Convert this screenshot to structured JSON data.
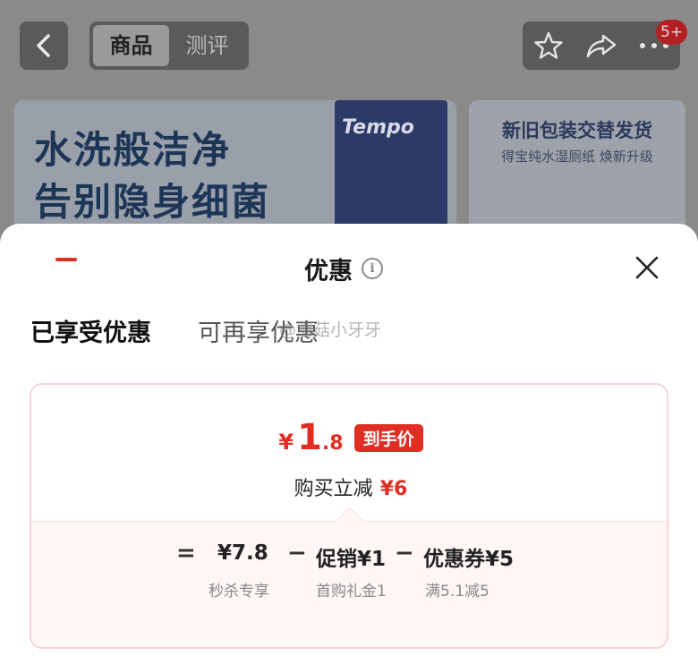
{
  "header": {
    "back_icon": "chevron-left-icon",
    "tabs": [
      "商品",
      "测评"
    ],
    "actions": [
      "star-icon",
      "share-icon",
      "more-icon"
    ],
    "badge": "5+"
  },
  "banner_left": {
    "line1": "水洗般洁净",
    "line2": "告别隐身细菌",
    "brand": "Tempo"
  },
  "banner_right": {
    "title": "新旧包装交替发货",
    "subtitle": "得宝纯水湿厕纸 焕新升级"
  },
  "sheet": {
    "title": "优惠",
    "tabs": [
      "已享受优惠",
      "可再享优惠"
    ],
    "active_tab": 0,
    "watermark": "@蘑菇小牙牙",
    "final_price": {
      "symbol": "¥",
      "integer": "1",
      "decimal": ".8",
      "tag": "到手价"
    },
    "instant_discount": {
      "label": "购买立减",
      "amount": "¥6"
    },
    "breakdown": {
      "equals": "=",
      "minus": "−",
      "original": {
        "value": "¥7.8",
        "label": "秒杀专享"
      },
      "promo": {
        "value": "促销¥1",
        "label": "首购礼金1"
      },
      "coupon": {
        "value": "优惠券¥5",
        "label": "满5.1减5"
      }
    }
  },
  "colors": {
    "accent": "#e02e24",
    "card_border": "#f6d3d8",
    "breakdown_bg": "#fff6f6"
  }
}
